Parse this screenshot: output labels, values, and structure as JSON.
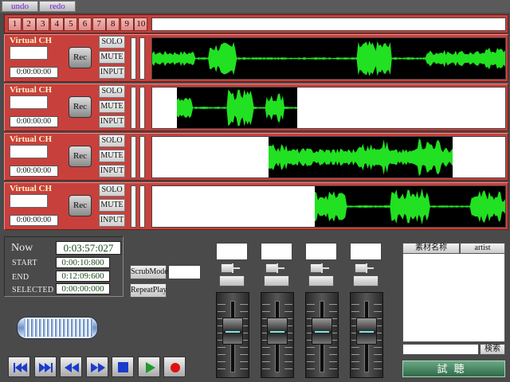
{
  "toolbar": {
    "undo": "undo",
    "redo": "redo"
  },
  "channel_numbers": [
    "1",
    "2",
    "3",
    "4",
    "5",
    "6",
    "7",
    "8",
    "9",
    "10"
  ],
  "tracks": [
    {
      "label": "Virtual CH",
      "time": "0:00:00:00",
      "rec": "Rec",
      "solo": "SOLO",
      "mute": "MUTE",
      "input": "INPUT",
      "clip": {
        "start": 0.0,
        "end": 1.0
      }
    },
    {
      "label": "Virtual CH",
      "time": "0:00:00:00",
      "rec": "Rec",
      "solo": "SOLO",
      "mute": "MUTE",
      "input": "INPUT",
      "clip": {
        "start": 0.07,
        "end": 0.41
      }
    },
    {
      "label": "Virtual CH",
      "time": "0:00:00:00",
      "rec": "Rec",
      "solo": "SOLO",
      "mute": "MUTE",
      "input": "INPUT",
      "clip": {
        "start": 0.33,
        "end": 0.85
      }
    },
    {
      "label": "Virtual CH",
      "time": "0:00:00:00",
      "rec": "Rec",
      "solo": "SOLO",
      "mute": "MUTE",
      "input": "INPUT",
      "clip": {
        "start": 0.46,
        "end": 1.0
      }
    }
  ],
  "timecode": {
    "now_label": "Now",
    "now": "0:03:57:027",
    "start_label": "START",
    "start": "0:00:10:800",
    "end_label": "END",
    "end": "0:12:09:600",
    "selected_label": "SELECTED",
    "selected": "0:00:00:000"
  },
  "controls": {
    "scrub": "ScrubMode",
    "repeat": "RepeatPlay"
  },
  "transport": [
    {
      "name": "skip-to-start-icon"
    },
    {
      "name": "skip-to-end-icon"
    },
    {
      "name": "rewind-icon"
    },
    {
      "name": "fast-forward-icon"
    },
    {
      "name": "stop-icon"
    },
    {
      "name": "play-icon"
    },
    {
      "name": "record-icon"
    }
  ],
  "library": {
    "col_name": "素材名称",
    "col_artist": "artist",
    "search": "検索",
    "listen": "試聴"
  },
  "colors": {
    "track_red": "#c8403c",
    "waveform": "#22e022",
    "record": "#e01010",
    "play": "#1e9a2e",
    "transport_blue": "#1a3ccc"
  }
}
